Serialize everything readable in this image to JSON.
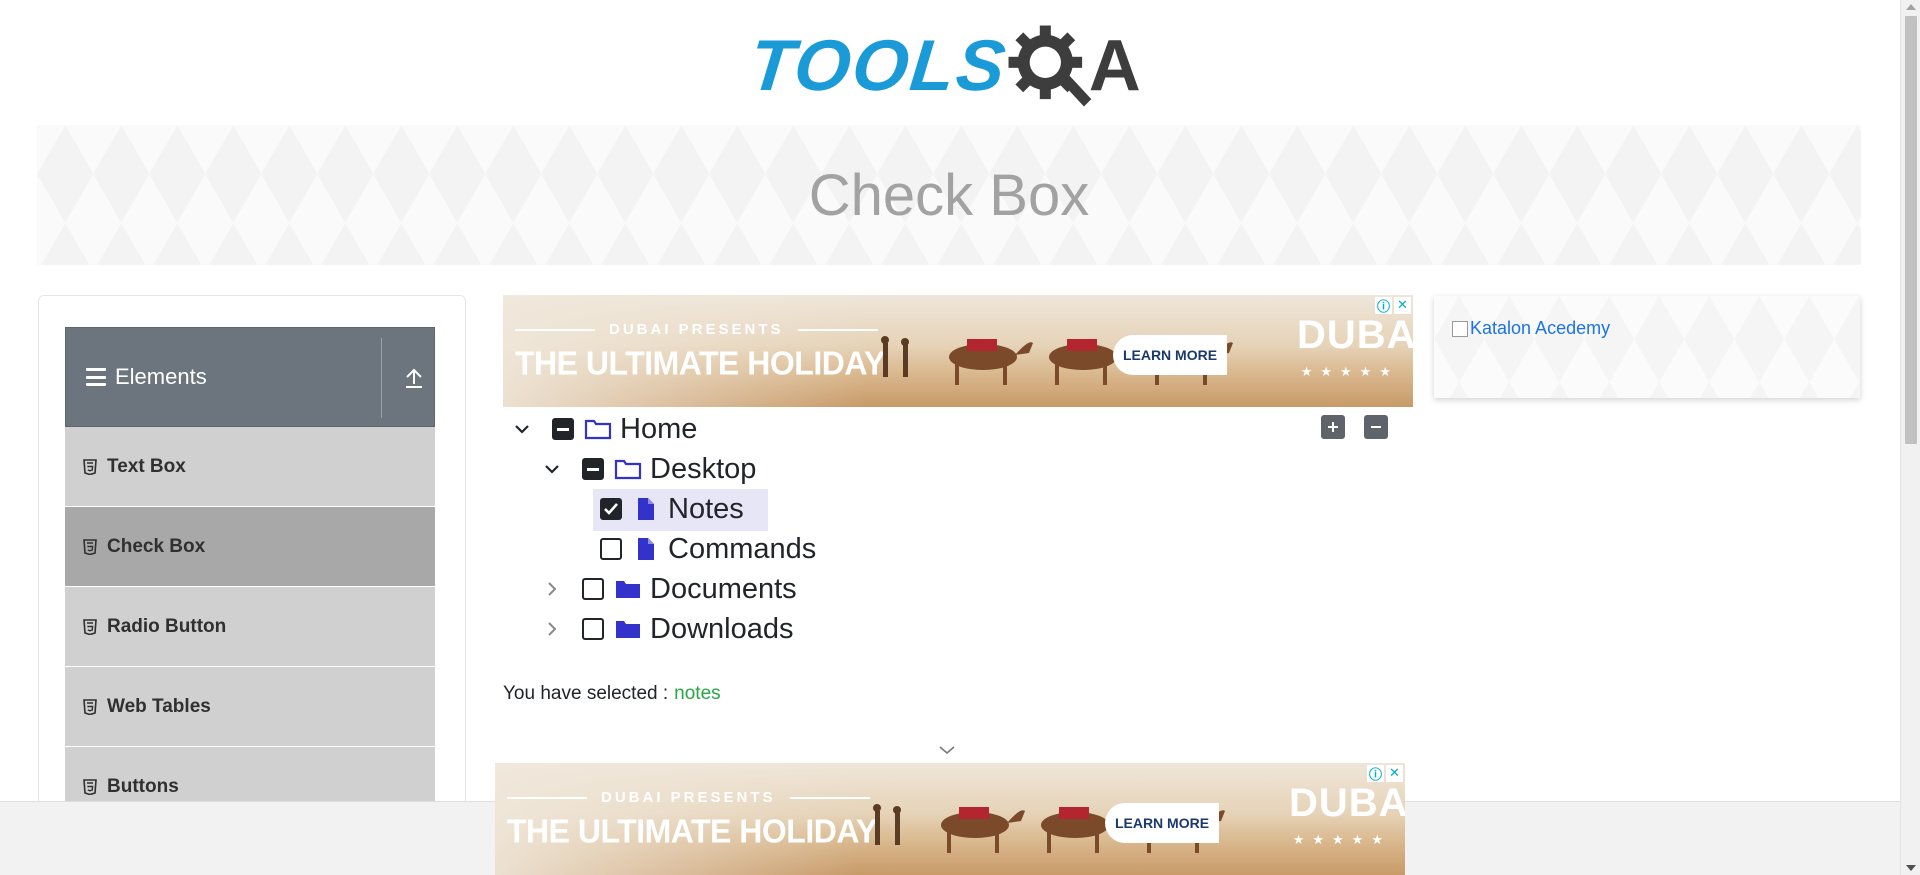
{
  "header": {
    "logo_tools": "TOOLS",
    "logo_a": "A"
  },
  "banner": {
    "title": "Check Box"
  },
  "sidebar": {
    "group_title": "Elements",
    "items": [
      {
        "label": "Text Box",
        "active": false
      },
      {
        "label": "Check Box",
        "active": true
      },
      {
        "label": "Radio Button",
        "active": false
      },
      {
        "label": "Web Tables",
        "active": false
      },
      {
        "label": "Buttons",
        "active": false
      }
    ]
  },
  "ad": {
    "presents": "DUBAI PRESENTS",
    "headline": "THE ULTIMATE HOLIDAY",
    "cta": "LEARN MORE",
    "brand": "DUBAI",
    "stars": "★★★★★"
  },
  "tree": {
    "nodes": [
      {
        "label": "Home",
        "state": "half",
        "expanded": true
      },
      {
        "label": "Desktop",
        "state": "half",
        "expanded": true
      },
      {
        "label": "Notes",
        "state": "checked"
      },
      {
        "label": "Commands",
        "state": "unchecked"
      },
      {
        "label": "Documents",
        "state": "unchecked",
        "expanded": false
      },
      {
        "label": "Downloads",
        "state": "unchecked",
        "expanded": false
      }
    ]
  },
  "result": {
    "prefix": "You have selected :",
    "selected": "notes"
  },
  "right_ad": {
    "alt": "Katalon Acedemy"
  },
  "colors": {
    "accent_blue": "#1a9bd7",
    "selected_green": "#28a745",
    "sidebar_header": "#6c757d",
    "folder_icon": "#3333cc"
  }
}
